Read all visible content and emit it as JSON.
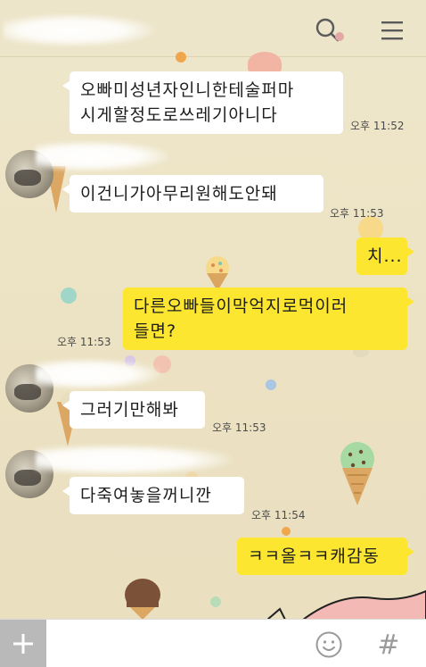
{
  "header": {
    "search_icon": "search-icon",
    "menu_icon": "menu-icon"
  },
  "messages": [
    {
      "direction": "in",
      "text": "오빠미성년자인니한테술퍼마\n시게할정도로쓰레기아니다",
      "time": "오후 11:52"
    },
    {
      "direction": "in",
      "text": "이건니가아무리원해도안돼",
      "time": "오후 11:53"
    },
    {
      "direction": "out",
      "text": "치...",
      "time": ""
    },
    {
      "direction": "out",
      "text": "다른오빠들이막억지로먹이러\n들면?",
      "time": "오후 11:53"
    },
    {
      "direction": "in",
      "text": "그러기만해봐",
      "time": "오후 11:53"
    },
    {
      "direction": "in",
      "text": "다죽여놓을꺼니깐",
      "time": "오후 11:54"
    },
    {
      "direction": "out",
      "text": "ㅋㅋ올ㅋㅋ캐감동",
      "time": ""
    }
  ],
  "input_bar": {
    "plus_icon": "plus-icon",
    "emoji_icon": "emoji-icon",
    "hash_icon": "hash-icon",
    "hash_label": "#"
  },
  "colors": {
    "background": "#ece3c6",
    "incoming_bubble": "#ffffff",
    "outgoing_bubble": "#fce630"
  }
}
